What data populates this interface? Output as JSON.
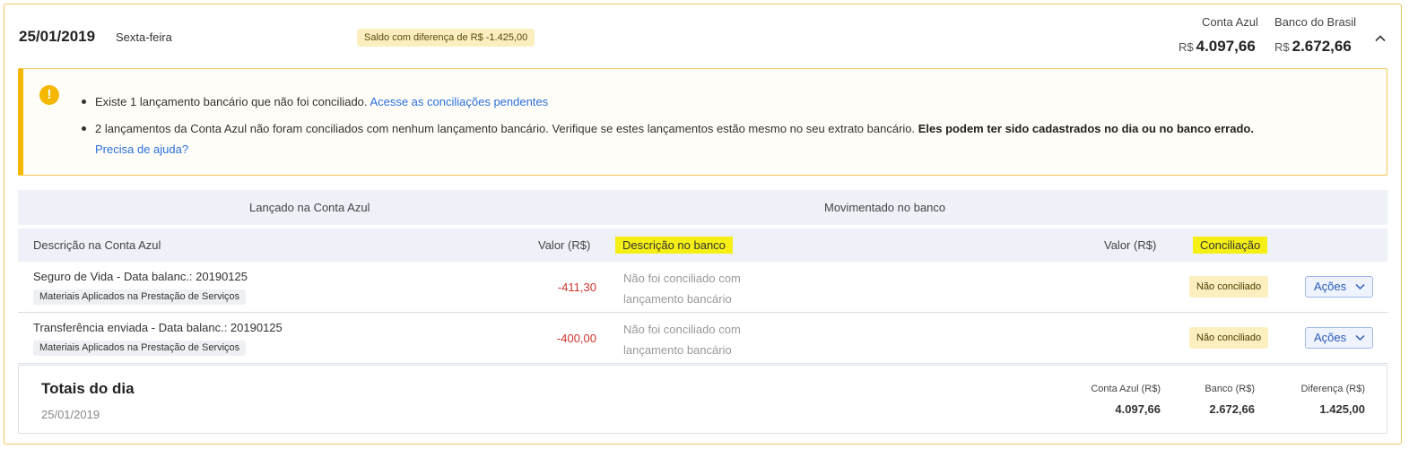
{
  "header": {
    "date": "25/01/2019",
    "weekday": "Sexta-feira",
    "diff_badge": "Saldo com diferença de R$ -1.425,00",
    "conta_azul_label": "Conta Azul",
    "conta_azul_currency": "R$",
    "conta_azul_value": "4.097,66",
    "banco_label": "Banco do Brasil",
    "banco_currency": "R$",
    "banco_value": "2.672,66",
    "collapse_icon": "chevron-up-icon"
  },
  "alert": {
    "icon": "exclamation-icon",
    "item1_text": "Existe 1 lançamento bancário que não foi conciliado.",
    "item1_link": "Acesse as conciliações pendentes",
    "item2_text": "2 lançamentos da Conta Azul não foram conciliados com nenhum lançamento bancário. Verifique se estes lançamentos estão mesmo no seu extrato bancário.",
    "item2_bold": "Eles podem ter sido cadastrados no dia ou no banco errado.",
    "item2_link": "Precisa de ajuda?"
  },
  "table": {
    "group_left": "Lançado na Conta Azul",
    "group_right": "Movimentado no banco",
    "col_desc": "Descrição na Conta Azul",
    "col_valor": "Valor (R$)",
    "col_desc_banco": "Descrição no banco",
    "col_valor_banco": "Valor (R$)",
    "col_conciliacao": "Conciliação",
    "rows": [
      {
        "desc": "Seguro de Vida - Data balanc.: 20190125",
        "tag": "Materiais Aplicados na Prestação de Serviços",
        "value": "-411,30",
        "bank_desc": "Não foi conciliado com lançamento bancário",
        "status": "Não conciliado",
        "actions": "Ações"
      },
      {
        "desc": "Transferência enviada - Data balanc.: 20190125",
        "tag": "Materiais Aplicados na Prestação de Serviços",
        "value": "-400,00",
        "bank_desc": "Não foi conciliado com lançamento bancário",
        "status": "Não conciliado",
        "actions": "Ações"
      }
    ]
  },
  "totals": {
    "title": "Totais do dia",
    "date": "25/01/2019",
    "conta_azul_label": "Conta Azul (R$)",
    "conta_azul_value": "4.097,66",
    "banco_label": "Banco (R$)",
    "banco_value": "2.672,66",
    "diferenca_label": "Diferença (R$)",
    "diferenca_value": "1.425,00"
  },
  "colors": {
    "accent_border": "#f5b700",
    "negative": "#d0342c",
    "link": "#2a6fdb",
    "highlight": "#f5ef16"
  }
}
